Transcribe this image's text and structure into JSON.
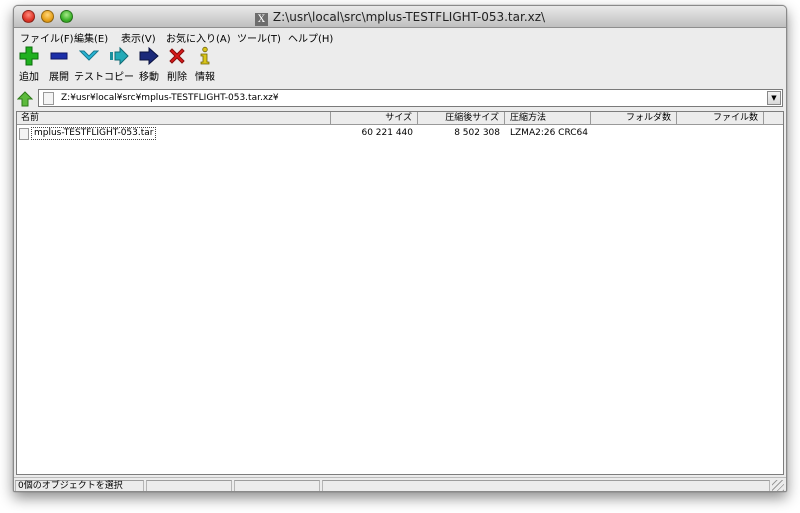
{
  "window": {
    "title": "Z:\\usr\\local\\src\\mplus-TESTFLIGHT-053.tar.xz\\",
    "title_icon": "X"
  },
  "menu": [
    {
      "label": "ファイル(F)",
      "name": "menu-file"
    },
    {
      "label": "編集(E)",
      "name": "menu-edit"
    },
    {
      "label": "表示(V)",
      "name": "menu-view"
    },
    {
      "label": "お気に入り(A)",
      "name": "menu-favorites"
    },
    {
      "label": "ツール(T)",
      "name": "menu-tools"
    },
    {
      "label": "ヘルプ(H)",
      "name": "menu-help"
    }
  ],
  "toolbar": {
    "add": {
      "label": "追加",
      "icon": "plus-icon",
      "color": "#1fb01f"
    },
    "extract": {
      "label": "展開",
      "icon": "minus-icon",
      "color": "#1b2ea8"
    },
    "test": {
      "label": "テスト",
      "icon": "check-icon",
      "color": "#29b6d6"
    },
    "copy": {
      "label": "コピー",
      "icon": "copy-arrow-icon",
      "color": "#1c8f9c"
    },
    "move": {
      "label": "移動",
      "icon": "move-arrow-icon",
      "color": "#1b2a7a"
    },
    "delete": {
      "label": "削除",
      "icon": "delete-x-icon",
      "color": "#d81c1c"
    },
    "info": {
      "label": "情報",
      "icon": "info-icon",
      "color": "#d9c51a"
    }
  },
  "address": {
    "path": "Z:¥usr¥local¥src¥mplus-TESTFLIGHT-053.tar.xz¥"
  },
  "columns": {
    "name": "名前",
    "size": "サイズ",
    "packed": "圧縮後サイズ",
    "method": "圧縮方法",
    "folders": "フォルダ数",
    "files": "ファイル数"
  },
  "rows": [
    {
      "name": "mplus-TESTFLIGHT-053.tar",
      "size": "60 221 440",
      "packed": "8 502 308",
      "method": "LZMA2:26 CRC64"
    }
  ],
  "status": {
    "selection": "0個のオブジェクトを選択",
    "seg2": "",
    "seg3": "",
    "seg4": ""
  }
}
